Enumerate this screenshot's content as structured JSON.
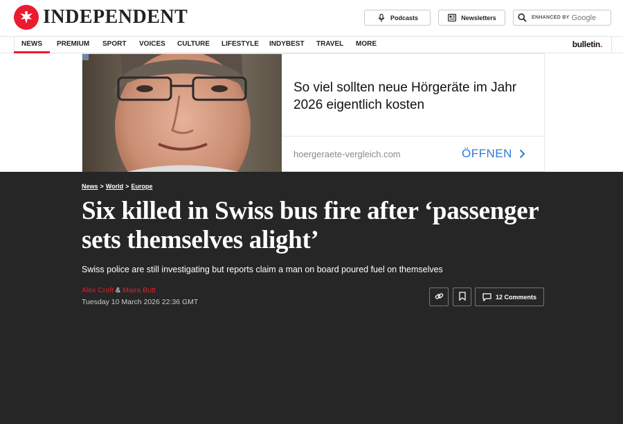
{
  "header": {
    "logo_text": "INDEPENDENT",
    "podcasts_label": "Podcasts",
    "newsletters_label": "Newsletters",
    "search": {
      "enhanced_label": "ENHANCED BY",
      "google_label": "Google"
    }
  },
  "nav": {
    "items": [
      "NEWS",
      "PREMIUM",
      "SPORT",
      "VOICES",
      "CULTURE",
      "LIFESTYLE",
      "INDYBEST",
      "TRAVEL",
      "MORE"
    ],
    "active": "NEWS",
    "bulletin": "bulletin",
    "bulletin_dot": "."
  },
  "ad": {
    "headline": "So viel sollten neue Hörgeräte im Jahr 2026 eigentlich kosten",
    "domain": "hoergeraete-vergleich.com",
    "cta": "ÖFFNEN"
  },
  "article": {
    "breadcrumb": [
      "News",
      "World",
      "Europe"
    ],
    "breadcrumb_sep": ">",
    "headline": "Six killed in Swiss bus fire after ‘passenger sets themselves alight’",
    "standfirst": "Swiss police are still investigating but reports claim a man on board poured fuel on themselves",
    "authors": [
      "Alex Croft",
      "Maira Butt"
    ],
    "author_joiner": "&",
    "date": "Tuesday 10 March 2026 22:36 GMT",
    "comments_label": "12 Comments"
  },
  "colors": {
    "brand_red": "#ec1a2e",
    "article_bg": "#262626",
    "ad_cta_blue": "#2b7bd6"
  },
  "icons": [
    "eagle-logo-icon",
    "microphone-icon",
    "newsletter-icon",
    "search-icon",
    "chevron-right-icon",
    "link-icon",
    "bookmark-icon",
    "comment-icon"
  ]
}
